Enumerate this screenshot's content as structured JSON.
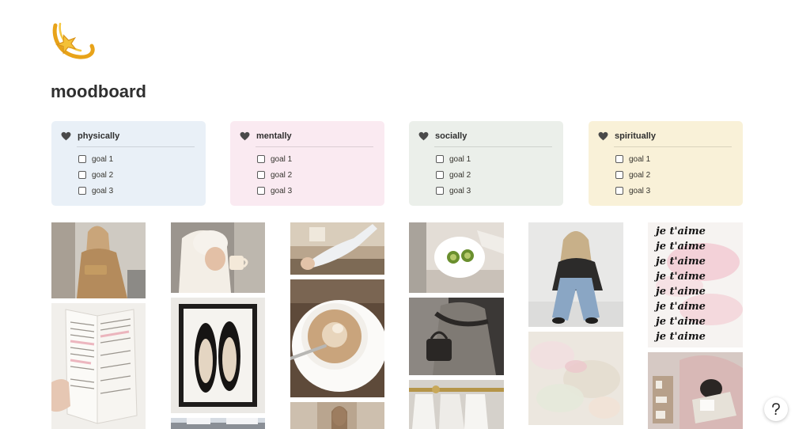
{
  "page": {
    "title": "moodboard",
    "icon": "shooting-star-icon"
  },
  "cards": [
    {
      "title": "physically",
      "color": "#e9f0f7",
      "icon": "heart-icon",
      "goals": [
        {
          "label": "goal 1",
          "checked": false
        },
        {
          "label": "goal 2",
          "checked": false
        },
        {
          "label": "goal 3",
          "checked": false
        }
      ]
    },
    {
      "title": "mentally",
      "color": "#faeaf1",
      "icon": "heart-icon",
      "goals": [
        {
          "label": "goal 1",
          "checked": false
        },
        {
          "label": "goal 2",
          "checked": false
        },
        {
          "label": "goal 3",
          "checked": false
        }
      ]
    },
    {
      "title": "socially",
      "color": "#ebefea",
      "icon": "heart-icon",
      "goals": [
        {
          "label": "goal 1",
          "checked": false
        },
        {
          "label": "goal 2",
          "checked": false
        },
        {
          "label": "goal 3",
          "checked": false
        }
      ]
    },
    {
      "title": "spiritually",
      "color": "#f9f1d8",
      "icon": "heart-icon",
      "goals": [
        {
          "label": "goal 1",
          "checked": false
        },
        {
          "label": "goal 2",
          "checked": false
        },
        {
          "label": "goal 3",
          "checked": false
        }
      ]
    }
  ],
  "gallery": {
    "columns": 6,
    "photos_per_column": 3,
    "image_words": [
      "je t'aime",
      "je t'aime",
      "je t'aime",
      "je t'aime",
      "je t'aime",
      "je t'aime",
      "je t'aime",
      "je t'aime"
    ]
  },
  "help_button": {
    "label": "?",
    "icon": "help-icon"
  },
  "colors": {
    "title": "#2f2f2f",
    "text": "#37352f",
    "heart": "#4a4a4a"
  }
}
